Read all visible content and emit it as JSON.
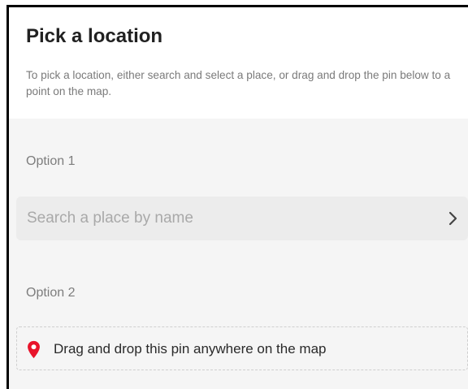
{
  "header": {
    "title": "Pick a location",
    "description": "To pick a location, either search and select a place, or drag and drop the pin below to a point on the map."
  },
  "option1": {
    "label": "Option 1",
    "search_placeholder": "Search a place by name",
    "search_value": "",
    "chevron_icon": "chevron-right-icon"
  },
  "option2": {
    "label": "Option 2",
    "pin_text": "Drag and drop this pin anywhere on the map",
    "pin_icon": "map-pin-icon"
  },
  "colors": {
    "pin": "#e8142b",
    "panel_background": "#f5f5f5",
    "search_background": "#ececec"
  }
}
